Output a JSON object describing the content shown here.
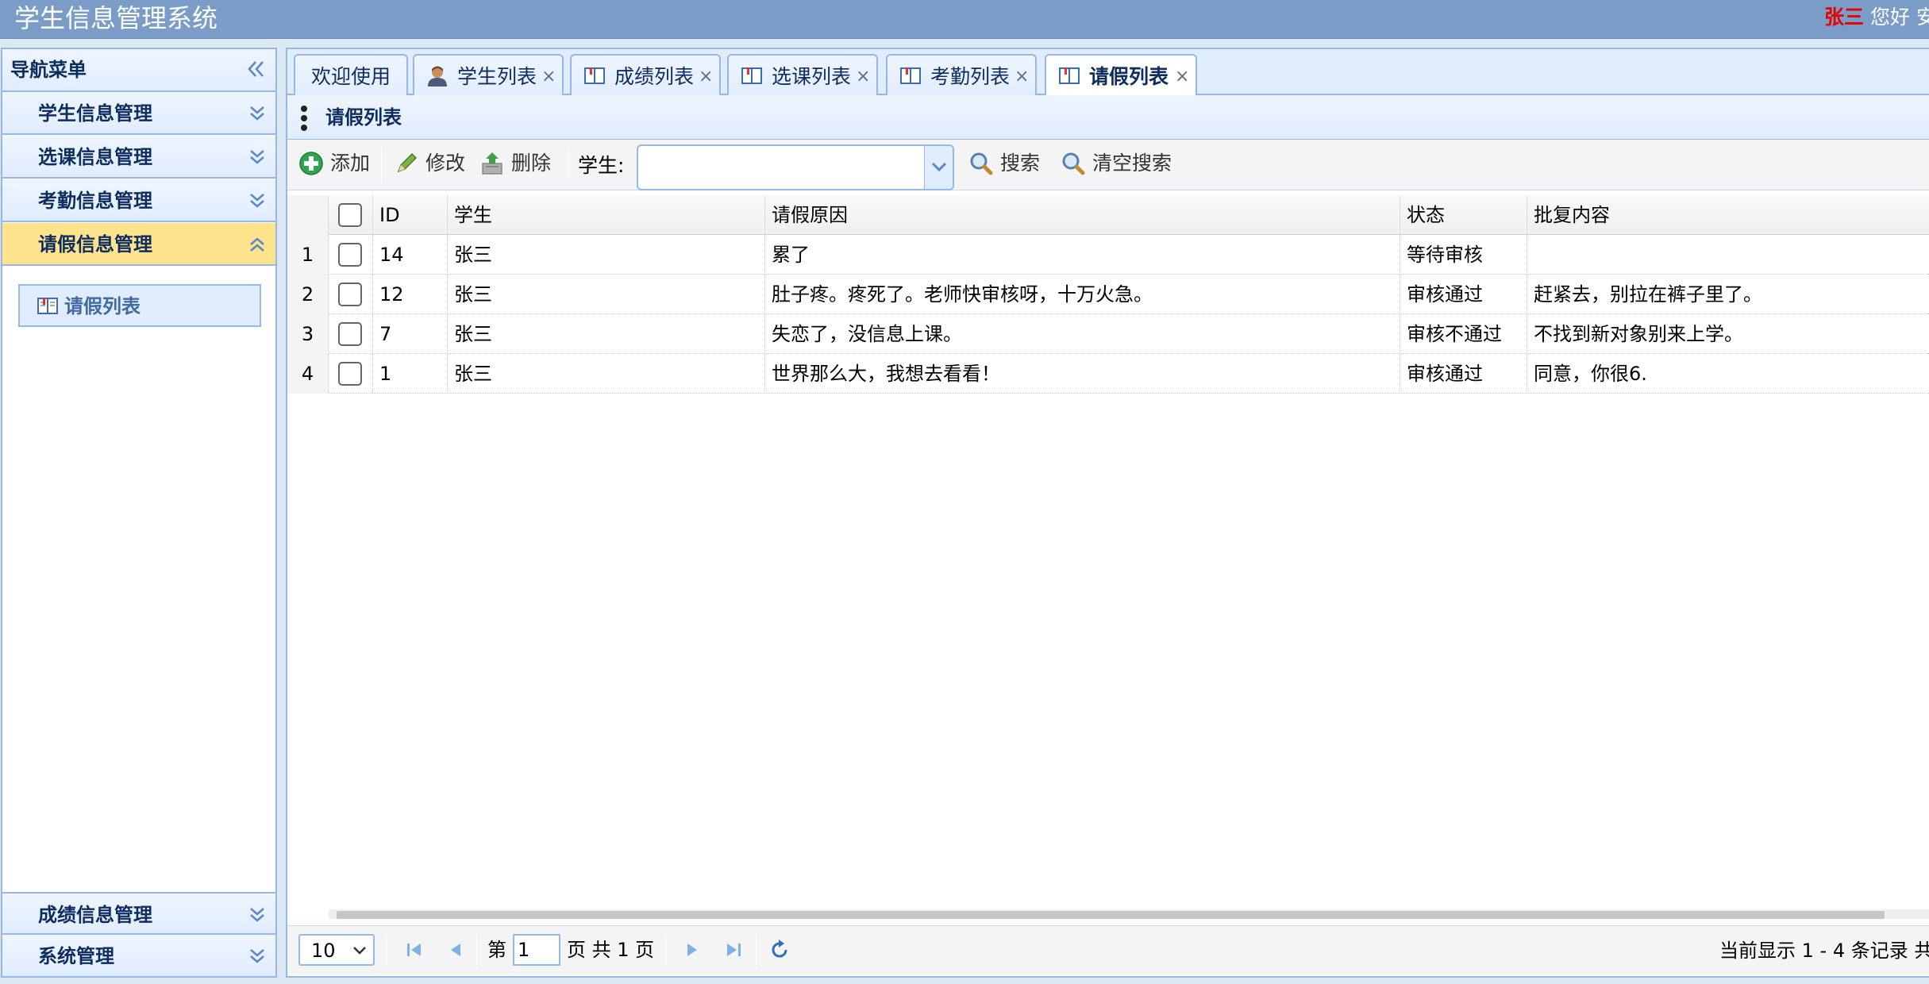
{
  "app": {
    "title": "学生信息管理系统",
    "user_name": "张三",
    "greeting": "您好",
    "greeting_extra": "安"
  },
  "nav": {
    "title": "导航菜单",
    "sections": [
      {
        "label": "学生信息管理",
        "state": "collapsed"
      },
      {
        "label": "选课信息管理",
        "state": "collapsed"
      },
      {
        "label": "考勤信息管理",
        "state": "collapsed"
      },
      {
        "label": "请假信息管理",
        "state": "expanded"
      },
      {
        "label": "成绩信息管理",
        "state": "collapsed"
      },
      {
        "label": "系统管理",
        "state": "collapsed"
      }
    ],
    "active_link": {
      "label": "请假列表",
      "icon": "book-icon"
    }
  },
  "tabs": [
    {
      "label": "欢迎使用",
      "icon": "",
      "closable": false
    },
    {
      "label": "学生列表",
      "icon": "user-icon",
      "closable": true
    },
    {
      "label": "成绩列表",
      "icon": "book-icon",
      "closable": true
    },
    {
      "label": "选课列表",
      "icon": "book-icon",
      "closable": true
    },
    {
      "label": "考勤列表",
      "icon": "book-icon",
      "closable": true
    },
    {
      "label": "请假列表",
      "icon": "book-icon",
      "closable": true,
      "selected": true
    }
  ],
  "close_glyph": "×",
  "panel": {
    "title": "请假列表"
  },
  "toolbar": {
    "add_label": "添加",
    "edit_label": "修改",
    "delete_label": "删除",
    "search_field_label": "学生:",
    "search_placeholder": "",
    "search_value": "",
    "search_label": "搜索",
    "clear_search_label": "清空搜索"
  },
  "grid": {
    "columns": [
      "ID",
      "学生",
      "请假原因",
      "状态",
      "批复内容"
    ],
    "rows": [
      {
        "num": "1",
        "id": "14",
        "student": "张三",
        "reason": "累了",
        "status": "等待审核",
        "reply": ""
      },
      {
        "num": "2",
        "id": "12",
        "student": "张三",
        "reason": "肚子疼。疼死了。老师快审核呀，十万火急。",
        "status": "审核通过",
        "reply": "赶紧去，别拉在裤子里了。"
      },
      {
        "num": "3",
        "id": "7",
        "student": "张三",
        "reason": "失恋了，没信息上课。",
        "status": "审核不通过",
        "reply": "不找到新对象别来上学。"
      },
      {
        "num": "4",
        "id": "1",
        "student": "张三",
        "reason": "世界那么大，我想去看看！",
        "status": "审核通过",
        "reply": "同意，你很6."
      }
    ]
  },
  "pager": {
    "page_size": "10",
    "page_prefix": "第",
    "page_value": "1",
    "page_suffix": "页 共 1 页",
    "display_info": "当前显示 1 - 4 条记录 共"
  },
  "colors": {
    "header_bg": "#7a9cc6",
    "border": "#95b8e7",
    "active_section": "#ffe48d",
    "user_name": "#e60000"
  }
}
